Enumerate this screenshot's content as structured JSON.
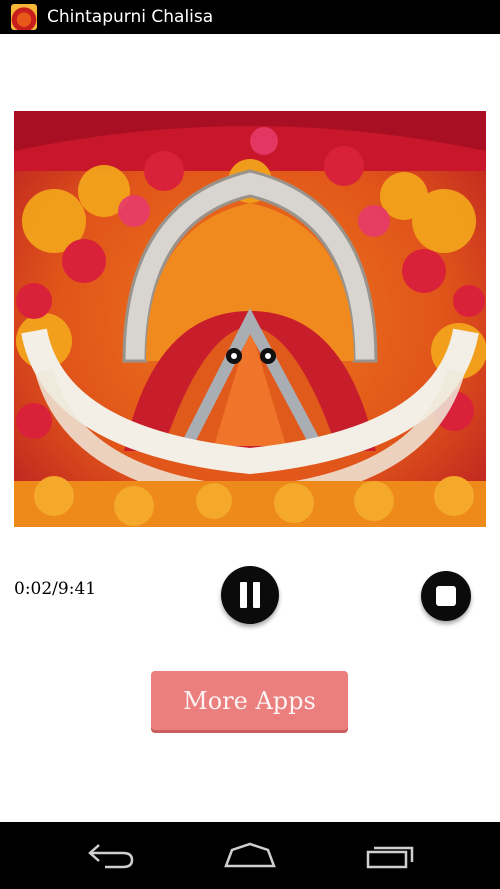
{
  "app": {
    "title": "Chintapurni Chalisa",
    "icon": "deity-app-icon"
  },
  "player": {
    "time": "0:02/9:41",
    "pause_icon": "pause-icon",
    "stop_icon": "stop-icon"
  },
  "more_apps": {
    "label": "More Apps",
    "color": "#ea7f7d"
  },
  "navbar": {
    "back_icon": "back-icon",
    "home_icon": "home-icon",
    "recent_icon": "recent-apps-icon"
  }
}
